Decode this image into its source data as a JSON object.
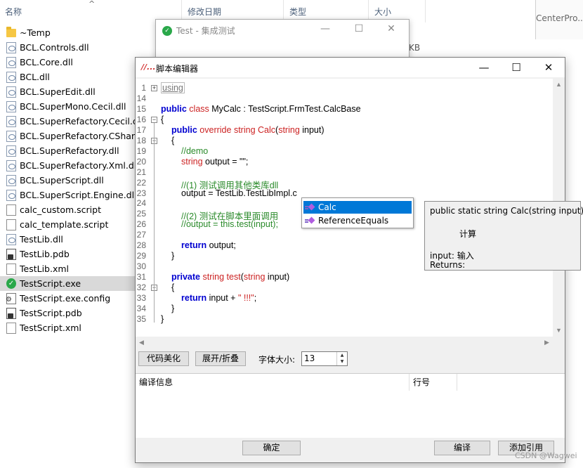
{
  "explorer": {
    "columns": {
      "name": "名称",
      "modified": "修改日期",
      "type": "类型",
      "size": "大小"
    },
    "partial_size": "KB",
    "side_text": "CenterPro...",
    "files": [
      {
        "name": "~Temp",
        "icon": "folder-icon",
        "kind": "folder"
      },
      {
        "name": "BCL.Controls.dll",
        "icon": "dll-file-icon",
        "kind": "dll"
      },
      {
        "name": "BCL.Core.dll",
        "icon": "dll-file-icon",
        "kind": "dll"
      },
      {
        "name": "BCL.dll",
        "icon": "dll-file-icon",
        "kind": "dll"
      },
      {
        "name": "BCL.SuperEdit.dll",
        "icon": "dll-file-icon",
        "kind": "dll"
      },
      {
        "name": "BCL.SuperMono.Cecil.dll",
        "icon": "dll-file-icon",
        "kind": "dll"
      },
      {
        "name": "BCL.SuperRefactory.Cecil.dll",
        "icon": "dll-file-icon",
        "kind": "dll"
      },
      {
        "name": "BCL.SuperRefactory.CSharp.dll",
        "icon": "dll-file-icon",
        "kind": "dll"
      },
      {
        "name": "BCL.SuperRefactory.dll",
        "icon": "dll-file-icon",
        "kind": "dll"
      },
      {
        "name": "BCL.SuperRefactory.Xml.dll",
        "icon": "dll-file-icon",
        "kind": "dll"
      },
      {
        "name": "BCL.SuperScript.dll",
        "icon": "dll-file-icon",
        "kind": "dll"
      },
      {
        "name": "BCL.SuperScript.Engine.dll",
        "icon": "dll-file-icon",
        "kind": "dll"
      },
      {
        "name": "calc_custom.script",
        "icon": "document-icon",
        "kind": "doc"
      },
      {
        "name": "calc_template.script",
        "icon": "document-icon",
        "kind": "doc"
      },
      {
        "name": "TestLib.dll",
        "icon": "dll-file-icon",
        "kind": "dll"
      },
      {
        "name": "TestLib.pdb",
        "icon": "pdb-file-icon",
        "kind": "pdb"
      },
      {
        "name": "TestLib.xml",
        "icon": "document-icon",
        "kind": "doc"
      },
      {
        "name": "TestScript.exe",
        "icon": "exe-check-icon",
        "kind": "exe",
        "selected": true
      },
      {
        "name": "TestScript.exe.config",
        "icon": "config-file-icon",
        "kind": "cfg"
      },
      {
        "name": "TestScript.pdb",
        "icon": "pdb-file-icon",
        "kind": "pdb"
      },
      {
        "name": "TestScript.xml",
        "icon": "document-icon",
        "kind": "doc"
      }
    ]
  },
  "bg_window": {
    "title": "Test - 集成测试",
    "icon": "check-circle-icon"
  },
  "editor": {
    "title": "脚本编辑器",
    "icon": "script-app-icon",
    "controls": {
      "minimize": "—",
      "maximize": "☐",
      "close": "✕"
    },
    "code_lines": [
      {
        "num": "1",
        "html": "<span class=\"collapsed-using\">using</span>",
        "indent": 0
      },
      {
        "num": "14",
        "html": "",
        "indent": 0
      },
      {
        "num": "15",
        "html": "<span class=\"kw\">public</span> <span class=\"kw2\">class</span> MyCalc : TestScript.FrmTest.CalcBase",
        "indent": 0
      },
      {
        "num": "16",
        "html": "{",
        "indent": 0
      },
      {
        "num": "17",
        "html": "<span class=\"kw\">public</span> <span class=\"kw2\">override</span> <span class=\"typ\">string</span> <span class=\"typ\">Calc</span>(<span class=\"typ\">string</span> input)",
        "indent": 1
      },
      {
        "num": "18",
        "html": "{",
        "indent": 1
      },
      {
        "num": "19",
        "html": "<span class=\"cm\">//demo</span>",
        "indent": 2
      },
      {
        "num": "20",
        "html": "<span class=\"typ\">string</span> output = \"\";",
        "indent": 2
      },
      {
        "num": "21",
        "html": "",
        "indent": 2
      },
      {
        "num": "22",
        "html": "<span class=\"cm\">//(1) 测试调用其他类库dll</span>",
        "indent": 2
      },
      {
        "num": "23",
        "html": "output = TestLib.TestLibImpl.c",
        "indent": 2
      },
      {
        "num": "24",
        "html": "",
        "indent": 2
      },
      {
        "num": "25",
        "html": "<span class=\"cm\">//(2) 测试在脚本里面调用</span>",
        "indent": 2
      },
      {
        "num": "26",
        "html": "<span class=\"cm\">//output = this.test(input);</span>",
        "indent": 2
      },
      {
        "num": "27",
        "html": "",
        "indent": 2
      },
      {
        "num": "28",
        "html": "<span class=\"kw\">return</span> output;",
        "indent": 2
      },
      {
        "num": "29",
        "html": "}",
        "indent": 1
      },
      {
        "num": "30",
        "html": "",
        "indent": 1
      },
      {
        "num": "31",
        "html": "<span class=\"kw\">private</span> <span class=\"typ\">string</span> <span class=\"typ\">test</span>(<span class=\"typ\">string</span> input)",
        "indent": 1
      },
      {
        "num": "32",
        "html": "{",
        "indent": 1
      },
      {
        "num": "33",
        "html": "<span class=\"kw\">return</span> input + <span class=\"kw2\">\" !!!\"</span>;",
        "indent": 2
      },
      {
        "num": "34",
        "html": "}",
        "indent": 1
      },
      {
        "num": "35",
        "html": "}",
        "indent": 0
      }
    ],
    "buttons": {
      "beautify": "代码美化",
      "fold": "展开/折叠",
      "ok": "确定",
      "compile": "编译",
      "add_ref": "添加引用"
    },
    "font_size_label": "字体大小:",
    "font_size_value": "13",
    "info_headers": {
      "info": "编译信息",
      "line": "行号"
    },
    "autocomplete": [
      {
        "label": "Calc",
        "icon": "method-icon",
        "selected": true
      },
      {
        "label": "ReferenceEquals",
        "icon": "method-icon",
        "selected": false
      }
    ],
    "tooltip": {
      "signature": "public static string Calc(string input);",
      "summary": "计算",
      "param": "input: 输入",
      "returns": "Returns:"
    }
  },
  "watermark": "CSDN @Wagwei"
}
